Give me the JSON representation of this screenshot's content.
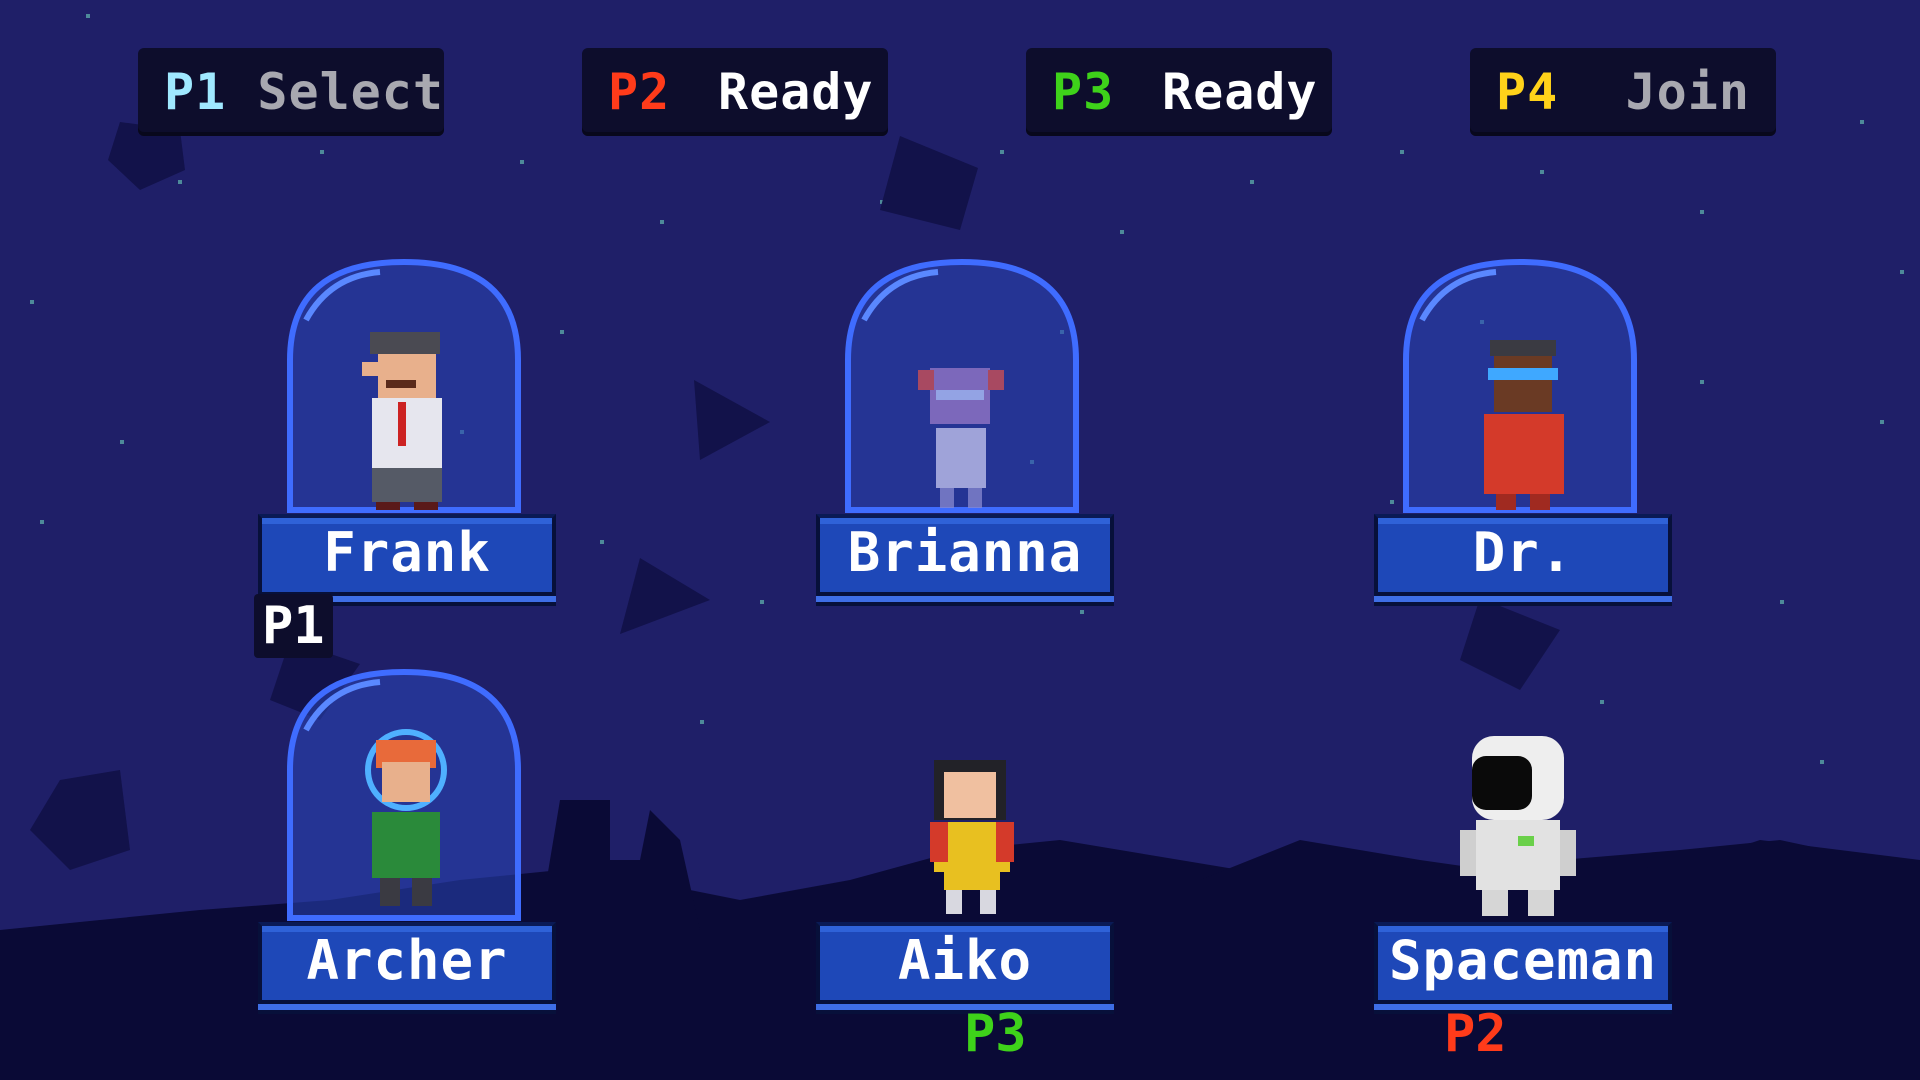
{
  "slots": [
    {
      "player": "P1",
      "status": "Select",
      "color": "#9fe8ff"
    },
    {
      "player": "P2",
      "status": "Ready",
      "color": "#ff3b1a"
    },
    {
      "player": "P3",
      "status": "Ready",
      "color": "#3ed21a"
    },
    {
      "player": "P4",
      "status": "Join",
      "color": "#ffd21a"
    }
  ],
  "characters": [
    {
      "name": "Frank",
      "in_capsule": true
    },
    {
      "name": "Brianna",
      "in_capsule": true
    },
    {
      "name": "Dr.",
      "in_capsule": true
    },
    {
      "name": "Archer",
      "in_capsule": true
    },
    {
      "name": "Aiko",
      "in_capsule": false
    },
    {
      "name": "Spaceman",
      "in_capsule": false
    }
  ],
  "cursors": [
    {
      "player": "P1",
      "character": "Frank"
    },
    {
      "player": "P3",
      "character": "Aiko"
    },
    {
      "player": "P2",
      "character": "Spaceman"
    }
  ],
  "colors": {
    "sky": "#1f1f68",
    "ground": "#0a0a36",
    "capsule_glass": "#2f4fd6",
    "plate": "#1e48b8"
  }
}
